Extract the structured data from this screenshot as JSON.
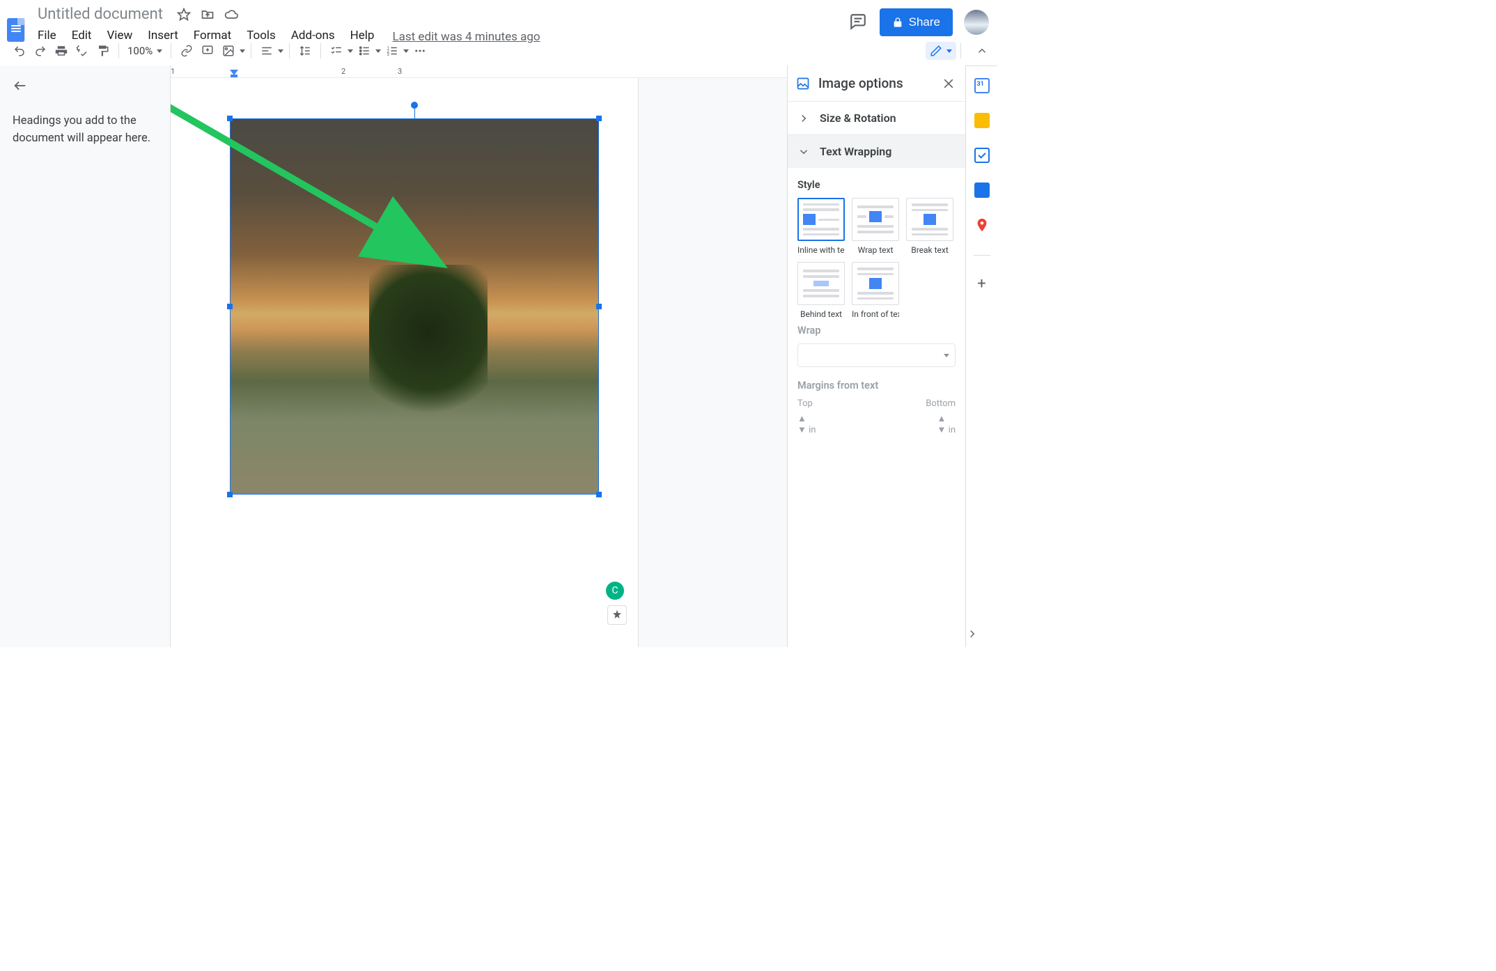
{
  "doc": {
    "title": "Untitled document"
  },
  "menu": {
    "items": [
      "File",
      "Edit",
      "View",
      "Insert",
      "Format",
      "Tools",
      "Add-ons",
      "Help"
    ],
    "last_edit": "Last edit was 4 minutes ago"
  },
  "header": {
    "share": "Share"
  },
  "toolbar": {
    "zoom": "100%"
  },
  "outline": {
    "placeholder": "Headings you add to the document will appear here."
  },
  "ruler": {
    "marks": [
      "1",
      "2",
      "3"
    ]
  },
  "sidepanel": {
    "title": "Image options",
    "sections": {
      "size_rotation": "Size & Rotation",
      "text_wrapping": "Text Wrapping"
    },
    "style_label": "Style",
    "styles": [
      {
        "label": "Inline with text",
        "selected": true
      },
      {
        "label": "Wrap text"
      },
      {
        "label": "Break text"
      },
      {
        "label": "Behind text"
      },
      {
        "label": "In front of text"
      }
    ],
    "wrap_label": "Wrap",
    "margins_label": "Margins from text",
    "margin_top": "Top",
    "margin_bottom": "Bottom",
    "unit": "in"
  },
  "badge": {
    "letter": "C"
  },
  "calendar_day": "31"
}
